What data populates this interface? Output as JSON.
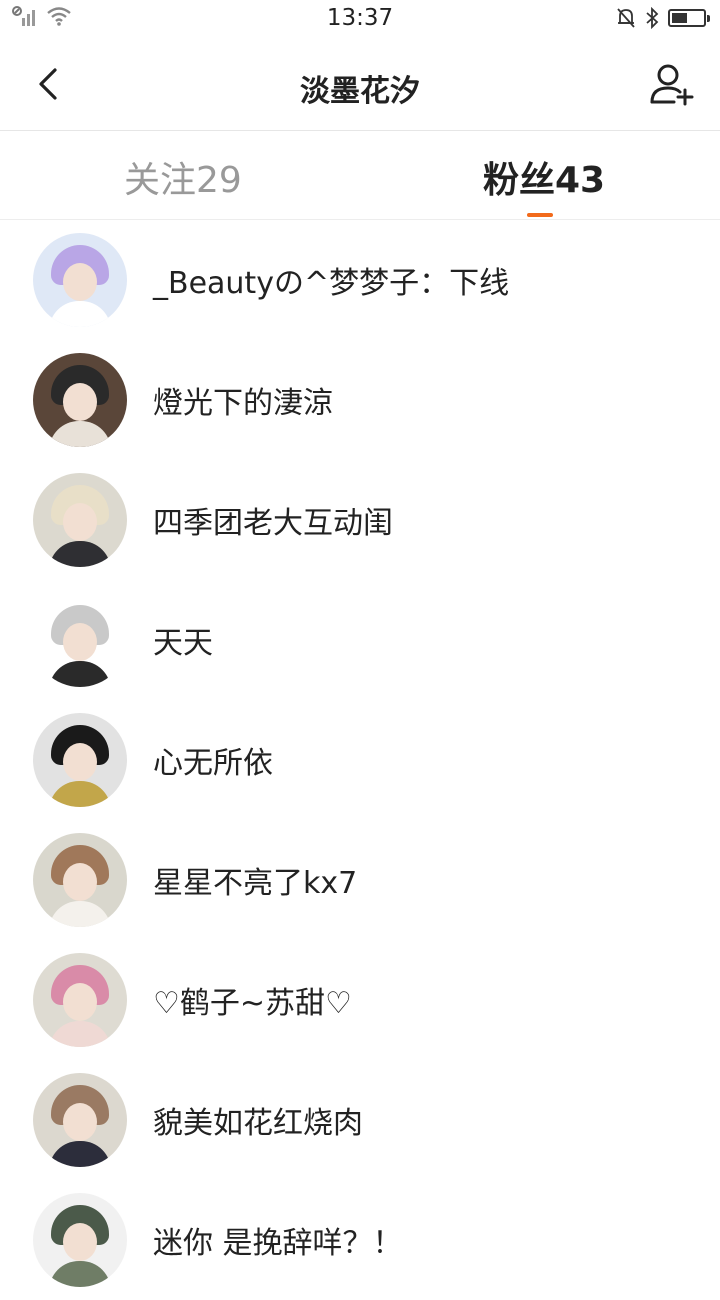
{
  "status_bar": {
    "time": "13:37",
    "icons": [
      "signal-icon",
      "wifi-icon",
      "mute-bell-icon",
      "bluetooth-icon",
      "battery-icon"
    ],
    "battery_level": 0.5
  },
  "header": {
    "title": "淡墨花汐",
    "icons": [
      "back-arrow-icon",
      "add-user-icon"
    ]
  },
  "tabs": {
    "following": "关注29",
    "fans": "粉丝43",
    "active": "fans",
    "accent_color": "#f26a1b"
  },
  "fans": [
    {
      "name": "_Beautyの^梦梦子：下线",
      "avatar_colors": {
        "bg": "#dfe8f6",
        "hair": "#b9a6e6",
        "body": "#ffffff"
      }
    },
    {
      "name": "燈光下的淒涼",
      "avatar_colors": {
        "bg": "#5a4639",
        "hair": "#2a2a2a",
        "body": "#e8e1d8"
      }
    },
    {
      "name": "四季团老大互动闺",
      "avatar_colors": {
        "bg": "#dcd9cf",
        "hair": "#e8dfc8",
        "body": "#2f2f33"
      }
    },
    {
      "name": "天天",
      "avatar_colors": {
        "bg": "#ffffff",
        "hair": "#c9c9c9",
        "body": "#2a2a2a"
      }
    },
    {
      "name": "心无所依",
      "avatar_colors": {
        "bg": "#e2e2e2",
        "hair": "#1a1a1a",
        "body": "#c2a64a"
      }
    },
    {
      "name": "星星不亮了kx7",
      "avatar_colors": {
        "bg": "#d9d7cd",
        "hair": "#a0785a",
        "body": "#f4f1ec"
      }
    },
    {
      "name": "♡鹤子~苏甜♡",
      "avatar_colors": {
        "bg": "#dedbd2",
        "hair": "#d98ba8",
        "body": "#efd9d4"
      }
    },
    {
      "name": "貌美如花红烧肉",
      "avatar_colors": {
        "bg": "#dcd8cf",
        "hair": "#9a7a63",
        "body": "#2c2d3b"
      }
    },
    {
      "name": "迷你 是挽辞咩？！",
      "avatar_colors": {
        "bg": "#f1f1f1",
        "hair": "#4b5a4a",
        "body": "#6f7d66"
      }
    }
  ]
}
